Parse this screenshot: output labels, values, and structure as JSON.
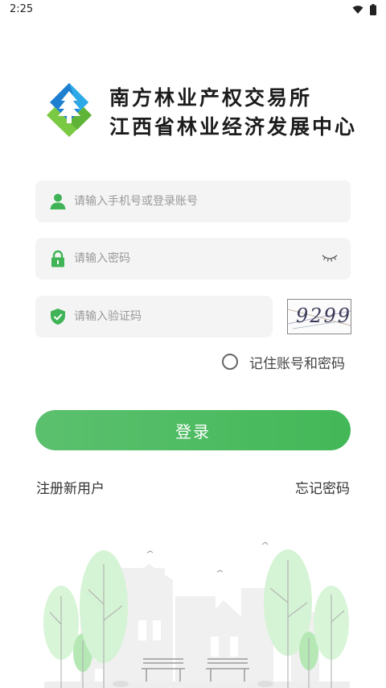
{
  "status_bar": {
    "time": "2:25"
  },
  "logo": {
    "line1": "南方林业产权交易所",
    "line2": "江西省林业经济发展中心"
  },
  "form": {
    "account": {
      "placeholder": "请输入手机号或登录账号",
      "value": ""
    },
    "password": {
      "placeholder": "请输入密码",
      "value": ""
    },
    "captcha_input": {
      "placeholder": "请输入验证码",
      "value": ""
    },
    "captcha_image_text": "9299",
    "remember_label": "记住账号和密码",
    "remember_checked": false
  },
  "login_button": "登录",
  "links": {
    "register": "注册新用户",
    "forgot": "忘记密码"
  },
  "colors": {
    "accent": "#43b858",
    "field_bg": "#f4f4f4",
    "logo_blue": "#1e7fd0",
    "logo_green": "#7ac943"
  },
  "icons": [
    "wifi-icon",
    "battery-icon",
    "user-icon",
    "lock-icon",
    "shield-check-icon",
    "eye-closed-icon"
  ]
}
